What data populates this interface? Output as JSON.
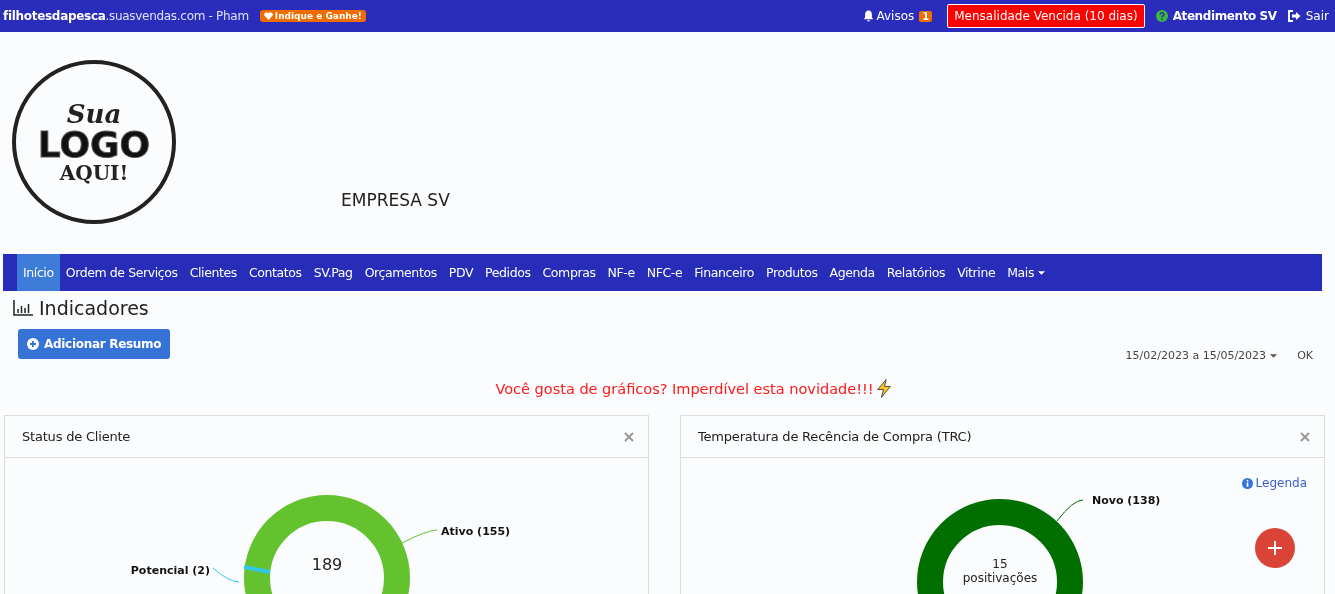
{
  "top_bar": {
    "site": "**filhotesdapesca**.suasvendas.com - Pham",
    "referral_badge": "Indique e Ganhe!",
    "notices": {
      "label": "Avisos",
      "count": "1"
    },
    "alert": "Mensalidade Vencida (10 dias)",
    "support": "Atendimento SV",
    "logout": "Sair"
  },
  "logo": {
    "line_1": "Sua",
    "line_2": "LOGO",
    "line_3": "AQUI!"
  },
  "company": "EMPRESA SV",
  "nav": [
    {
      "label": "Início",
      "selected": true
    },
    {
      "label": "Ordem de Serviços",
      "selected": false
    },
    {
      "label": "Clientes",
      "selected": false
    },
    {
      "label": "Contatos",
      "selected": false
    },
    {
      "label": "SV.Pag",
      "selected": false
    },
    {
      "label": "Orçamentos",
      "selected": false
    },
    {
      "label": "PDV",
      "selected": false
    },
    {
      "label": "Pedidos",
      "selected": false
    },
    {
      "label": "Compras",
      "selected": false
    },
    {
      "label": "NF-e",
      "selected": false
    },
    {
      "label": "NFC-e",
      "selected": false
    },
    {
      "label": "Financeiro",
      "selected": false
    },
    {
      "label": "Produtos",
      "selected": false
    },
    {
      "label": "Agenda",
      "selected": false
    },
    {
      "label": "Relatórios",
      "selected": false
    },
    {
      "label": "Vitrine",
      "selected": false
    },
    {
      "label": "Mais",
      "selected": false,
      "kind": "dropdown"
    }
  ],
  "page_title": "Indicadores",
  "add_button": "Adicionar Resumo",
  "date_range": "15/02/2023 a 15/05/2023",
  "ok_button": "OK",
  "promo": "Você gosta de gráficos? Imperdível esta novidade!!!",
  "cards": [
    {
      "title": "Status de Cliente",
      "center": [
        "189"
      ],
      "labels": [
        {
          "text": "Ativo (155)",
          "color": "#63c22e"
        },
        {
          "text": "Potencial (2)",
          "color": "#2fc8e8"
        }
      ]
    },
    {
      "title": "Temperatura de Recência de Compra (TRC)",
      "legend_link": "Legenda",
      "center": [
        "15",
        "positivações"
      ],
      "labels": [
        {
          "text": "Novo (138)",
          "color": "#006f00"
        }
      ]
    }
  ]
}
